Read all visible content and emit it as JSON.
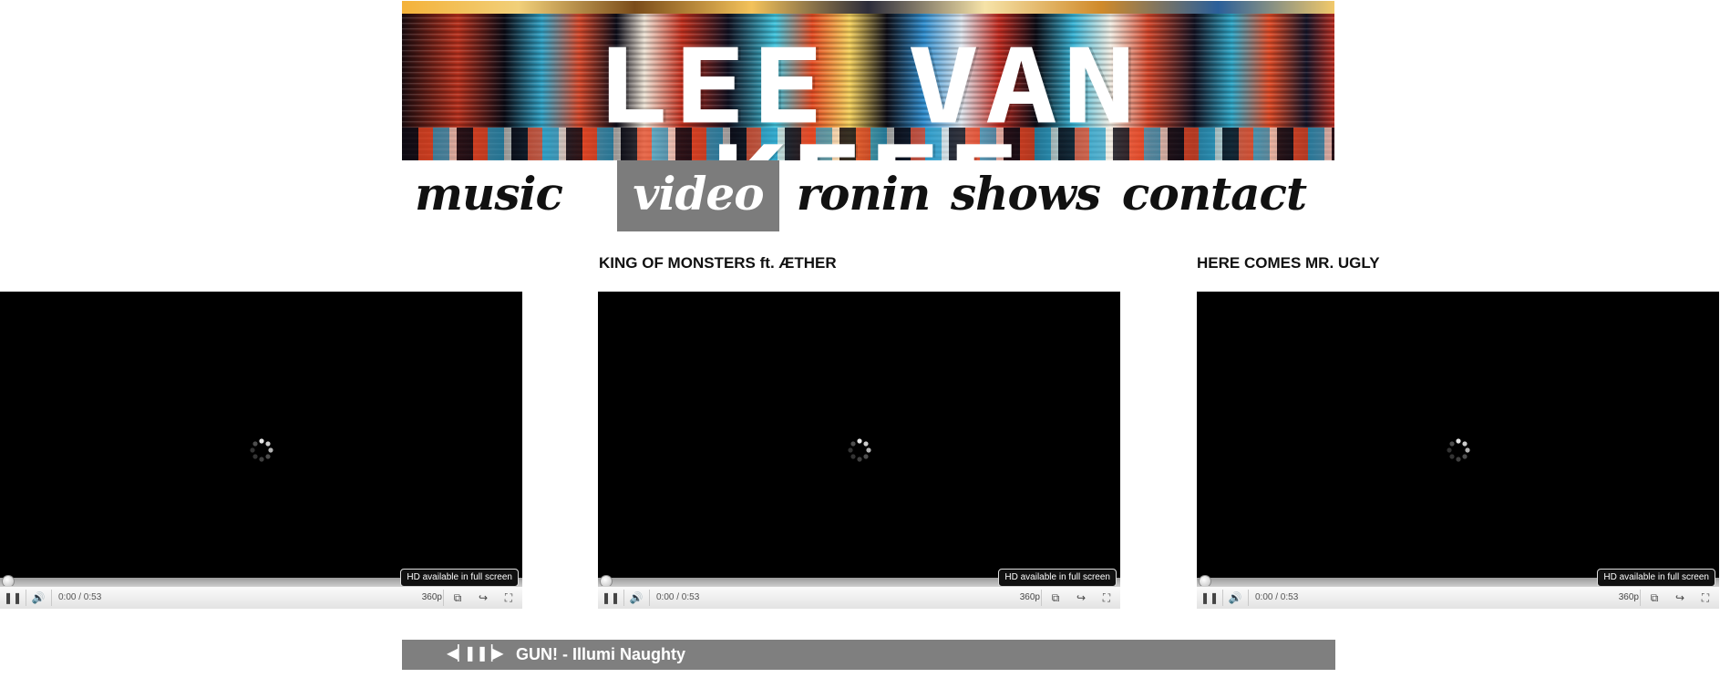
{
  "banner": {
    "title": "LEE VAN KEEF"
  },
  "nav": {
    "items": [
      {
        "label": "music"
      },
      {
        "label": "video",
        "active": true
      },
      {
        "label": "ronin"
      },
      {
        "label": "shows"
      },
      {
        "label": "contact"
      }
    ]
  },
  "videos": [
    {
      "title": "",
      "time": "0:00 / 0:53",
      "quality": "360p",
      "hd_tip": "HD available in full screen"
    },
    {
      "title": "KING OF MONSTERS ft. ÆTHER",
      "time": "0:00 / 0:53",
      "quality": "360p",
      "hd_tip": "HD available in full screen"
    },
    {
      "title": "HERE COMES MR. UGLY",
      "time": "0:00 / 0:53",
      "quality": "360p",
      "hd_tip": "HD available in full screen"
    }
  ],
  "music_player": {
    "track": "GUN! - Illumi Naughty",
    "prev_icon": "skip-back-icon",
    "pause_icon": "pause-icon",
    "next_icon": "skip-forward-icon"
  },
  "colors": {
    "nav_active_bg": "#7c7c7c",
    "music_bar_bg": "#7f7f7f",
    "player_bg": "#000000"
  }
}
